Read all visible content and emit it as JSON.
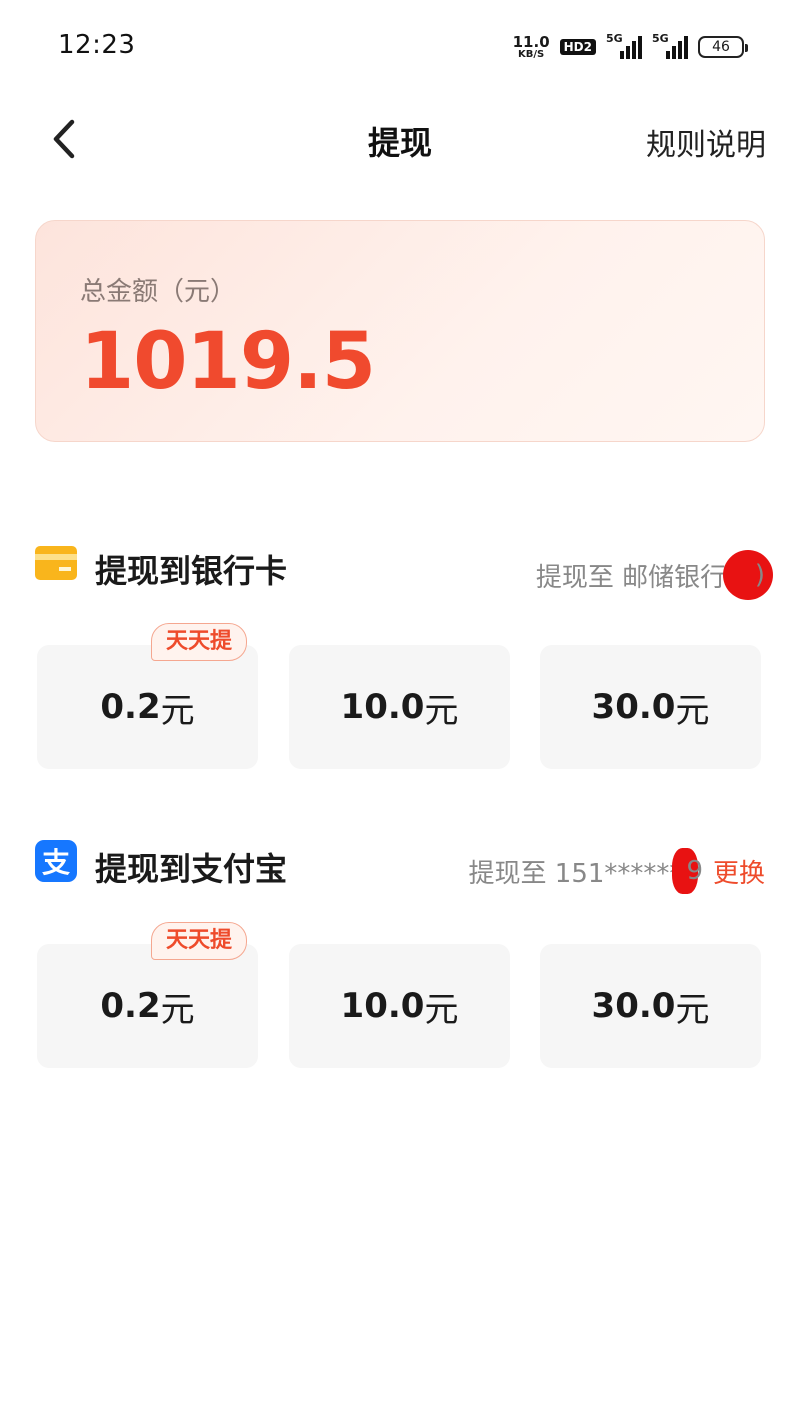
{
  "status_bar": {
    "time": "12:23",
    "net_speed_value": "11.0",
    "net_speed_unit": "KB/S",
    "hd_label": "HD2",
    "signal1_tag": "5G",
    "signal2_tag": "5G",
    "battery": "46"
  },
  "header": {
    "title": "提现",
    "rules_label": "规则说明"
  },
  "balance": {
    "label": "总金额（元）",
    "amount": "1019.5"
  },
  "bank_section": {
    "title": "提现到银行卡",
    "target_prefix": "提现至 邮储银行(4",
    "target_suffix": ")",
    "amounts": [
      {
        "value": "0.2",
        "unit": "元",
        "badge": "天天提"
      },
      {
        "value": "10.0",
        "unit": "元"
      },
      {
        "value": "30.0",
        "unit": "元"
      }
    ]
  },
  "alipay_section": {
    "title": "提现到支付宝",
    "icon_glyph": "支",
    "target_prefix": "提现至 151******",
    "target_suffix": "9",
    "change_label": "更换",
    "amounts": [
      {
        "value": "0.2",
        "unit": "元",
        "badge": "天天提"
      },
      {
        "value": "10.0",
        "unit": "元"
      },
      {
        "value": "30.0",
        "unit": "元"
      }
    ]
  },
  "colors": {
    "accent": "#f04a2e",
    "link": "#ee4b2b",
    "alipay_blue": "#1677ff",
    "bank_yellow": "#f9b51c"
  }
}
